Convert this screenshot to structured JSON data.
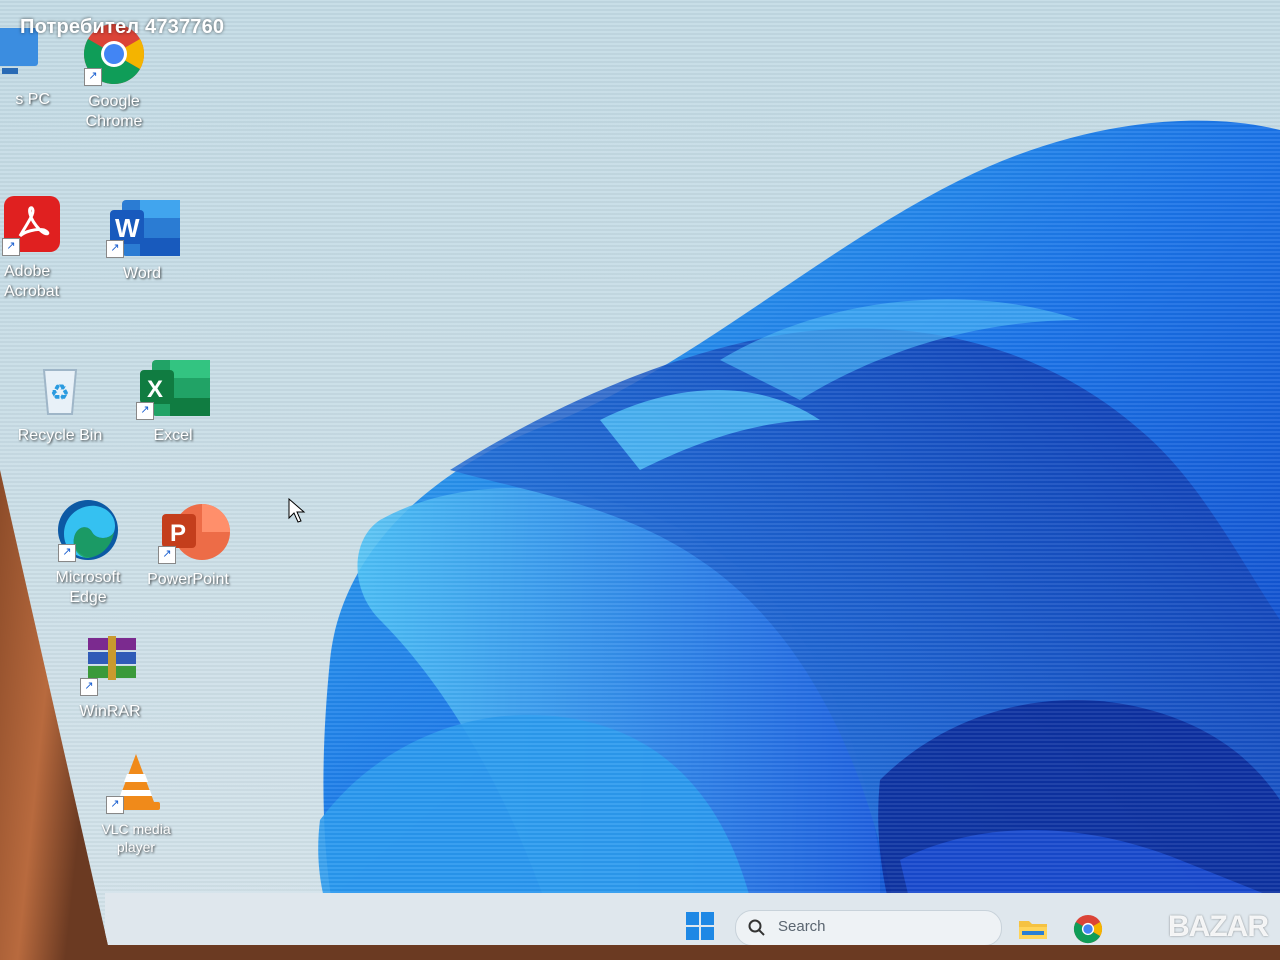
{
  "watermark": {
    "user": "Потребител 4737760",
    "site": "BAZAR"
  },
  "desktop": {
    "icons": [
      {
        "label": "s PC"
      },
      {
        "label": "Google\nChrome"
      },
      {
        "label": "Adobe\nAcrobat"
      },
      {
        "label": "Word"
      },
      {
        "label": "Recycle Bin"
      },
      {
        "label": "Excel"
      },
      {
        "label": "Microsoft\nEdge"
      },
      {
        "label": "PowerPoint"
      },
      {
        "label": "WinRAR"
      },
      {
        "label": "VLC media\nplayer"
      }
    ]
  },
  "taskbar": {
    "search_placeholder": "Search"
  },
  "icons": {
    "start": "windows-start-icon",
    "search": "search-icon",
    "file_explorer": "folder-icon",
    "chrome": "chrome-icon"
  },
  "colors": {
    "accent": "#1e88e5",
    "wallpaper_bloom": "#1565e8"
  }
}
